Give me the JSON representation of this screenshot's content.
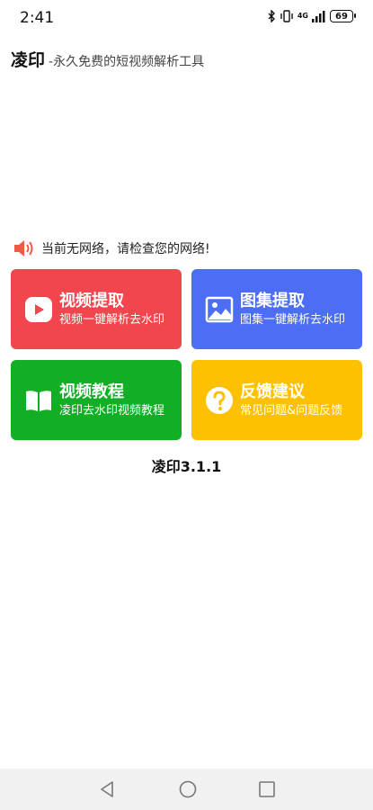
{
  "status_bar": {
    "time": "2:41",
    "network": "4G",
    "battery": "69",
    "icons": [
      "bluetooth-icon",
      "vibrate-icon",
      "signal-icon",
      "battery-icon"
    ]
  },
  "header": {
    "title": "凌印",
    "subtitle": "-永久免费的短视频解析工具"
  },
  "notice": {
    "icon": "speaker-icon",
    "text": "当前无网络，请检查您的网络!"
  },
  "cards": [
    {
      "title": "视频提取",
      "subtitle": "视频一键解析去水印",
      "icon": "play-icon",
      "color": "#f2464f"
    },
    {
      "title": "图集提取",
      "subtitle": "图集一键解析去水印",
      "icon": "image-icon",
      "color": "#4c6ef5"
    },
    {
      "title": "视频教程",
      "subtitle": "凌印去水印视频教程",
      "icon": "book-icon",
      "color": "#12ae25"
    },
    {
      "title": "反馈建议",
      "subtitle": "常见问题&问题反馈",
      "icon": "question-icon",
      "color": "#fec101"
    }
  ],
  "version": "凌印3.1.1",
  "nav": [
    "back-icon",
    "home-icon",
    "recent-apps-icon"
  ]
}
